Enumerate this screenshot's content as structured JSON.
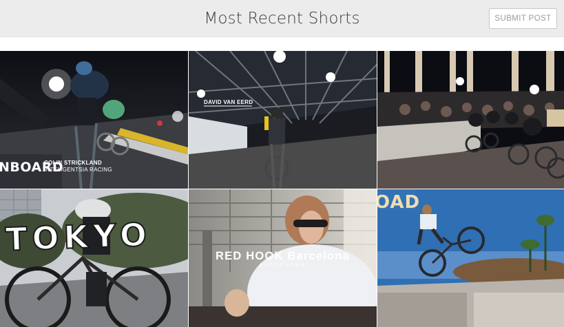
{
  "header": {
    "title": "Most Recent Shorts",
    "submit_label": "SUBMIT POST"
  },
  "tiles": [
    {
      "overlay_big": "NBOARD",
      "overlay_name": "COLIN STRICKLAND",
      "overlay_team": "INTELIGENTSIA RACING"
    },
    {
      "overlay_name": "DAVID VAN EERD"
    },
    {},
    {
      "overlay_big": "TOKYO"
    },
    {
      "overlay_title": "RED HOOK Barcelona",
      "overlay_sub": "BARCELONA"
    },
    {
      "overlay_big": "OAD"
    }
  ]
}
